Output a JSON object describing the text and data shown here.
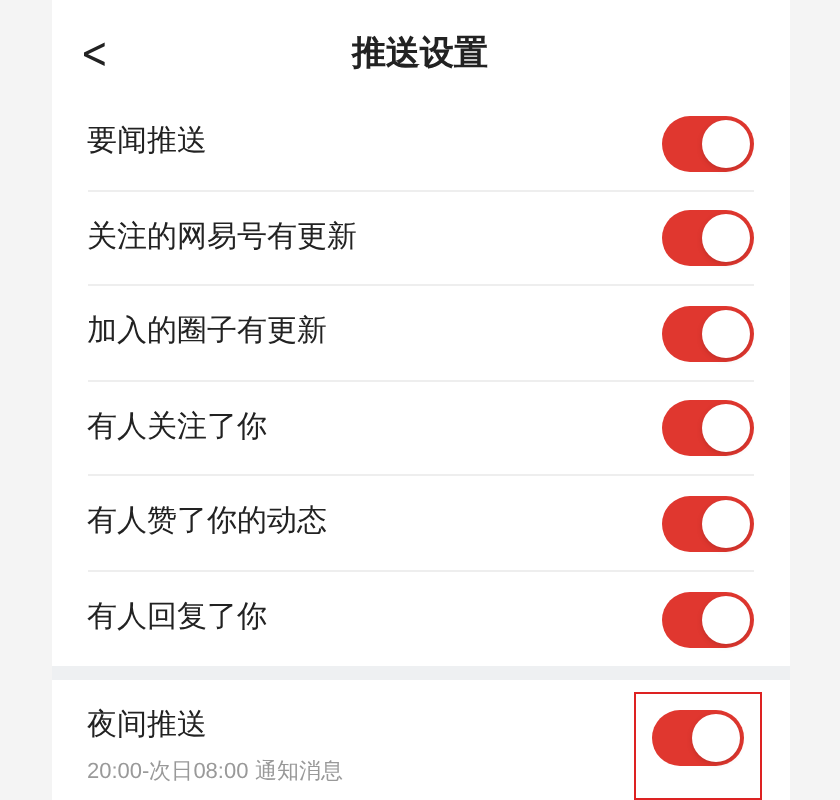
{
  "header": {
    "back": "<",
    "title": "推送设置"
  },
  "items": [
    {
      "label": "要闻推送",
      "on": true
    },
    {
      "label": "关注的网易号有更新",
      "on": true
    },
    {
      "label": "加入的圈子有更新",
      "on": true
    },
    {
      "label": "有人关注了你",
      "on": true
    },
    {
      "label": "有人赞了你的动态",
      "on": true
    },
    {
      "label": "有人回复了你",
      "on": true
    }
  ],
  "night": {
    "label": "夜间推送",
    "sublabel": "20:00-次日08:00 通知消息",
    "on": true,
    "highlighted": true
  }
}
